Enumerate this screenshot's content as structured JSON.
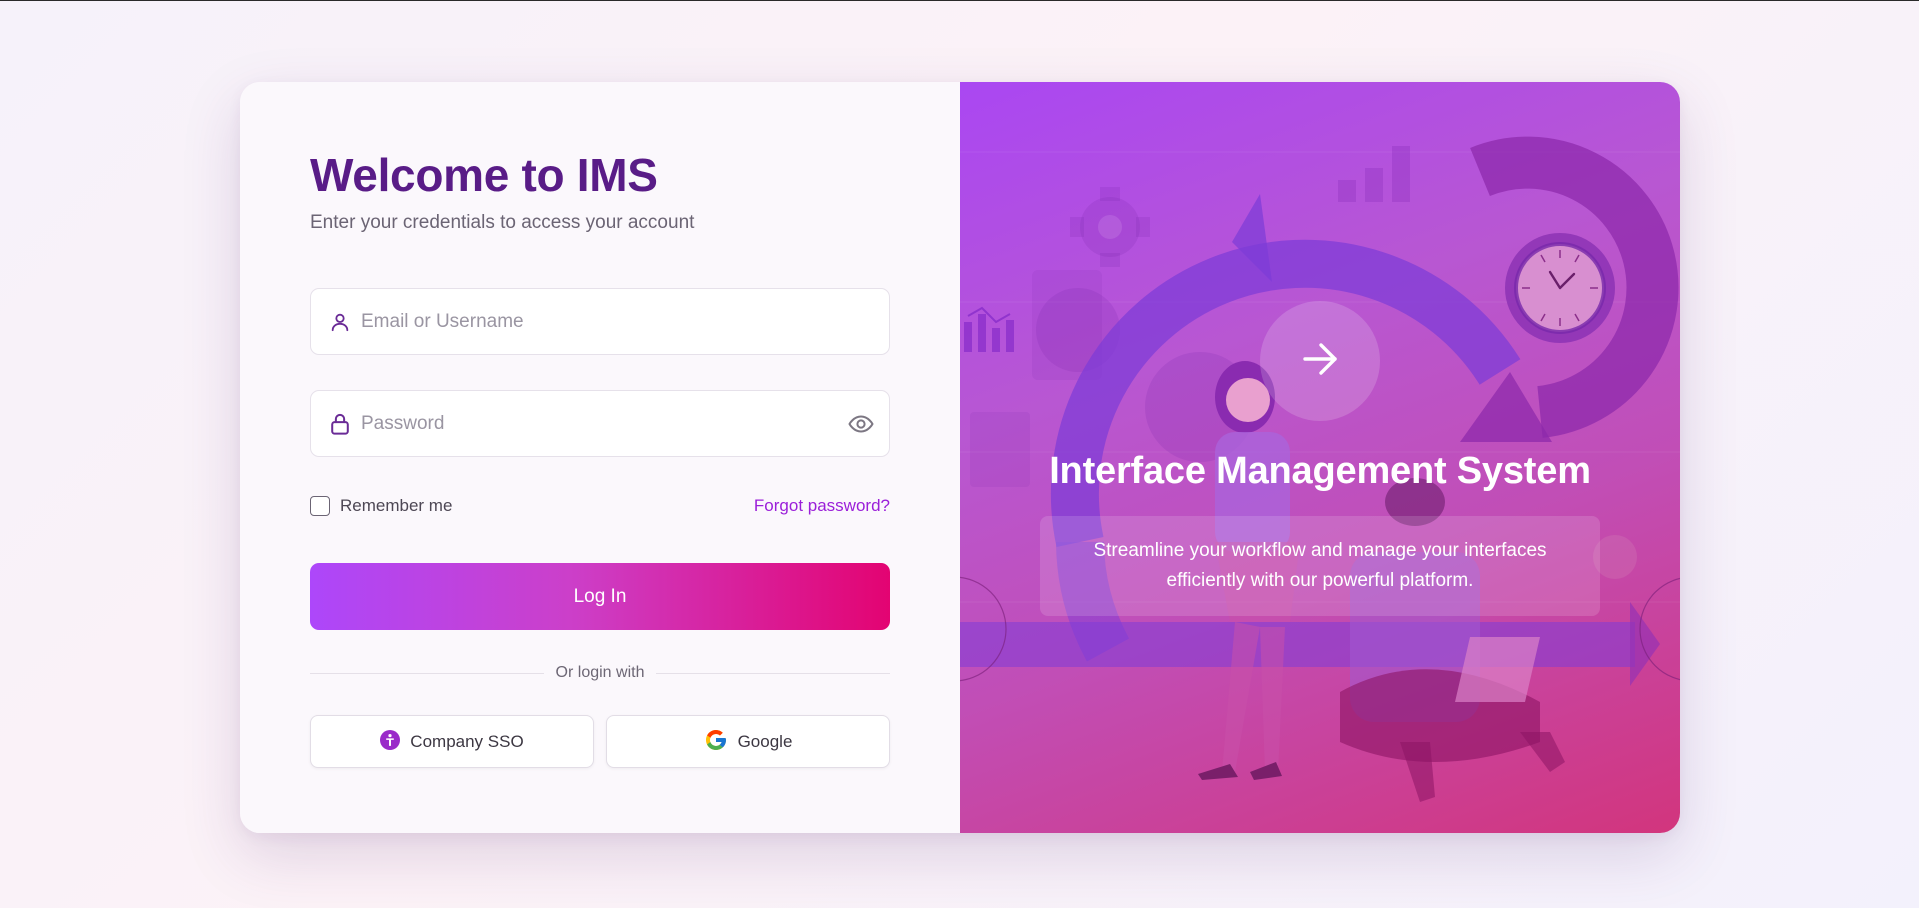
{
  "login": {
    "title": "Welcome to IMS",
    "subtitle": "Enter your credentials to access your account",
    "username_placeholder": "Email or Username",
    "password_placeholder": "Password",
    "remember_label": "Remember me",
    "forgot_label": "Forgot password?",
    "login_button": "Log In",
    "divider_text": "Or login with",
    "sso_button": "Company SSO",
    "google_button": "Google"
  },
  "hero": {
    "title": "Interface Management System",
    "description": "Streamline your workflow and manage your interfaces efficiently with our powerful platform."
  },
  "icons": {
    "username": "user-icon",
    "password": "lock-icon",
    "toggle_password": "eye-icon",
    "sso": "company-sso-icon",
    "google": "google-icon",
    "hero_action": "arrow-right-icon"
  },
  "colors": {
    "brand_purple": "#591c87",
    "accent_link": "#9b1fd9",
    "button_gradient_start": "#ad47fa",
    "button_gradient_end": "#e30472"
  }
}
